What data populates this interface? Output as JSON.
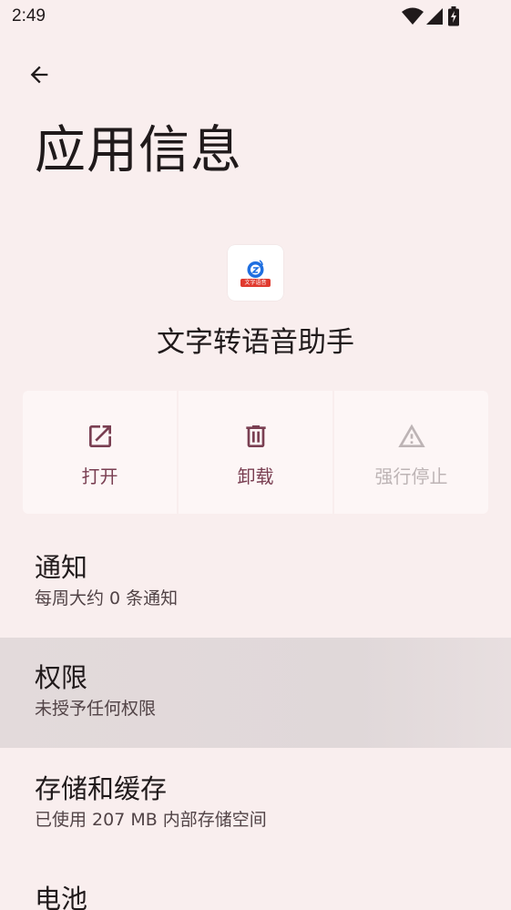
{
  "status_bar": {
    "time": "2:49"
  },
  "header": {
    "title": "应用信息"
  },
  "app": {
    "name": "文字转语音助手",
    "icon_label": "文字语音"
  },
  "actions": [
    {
      "label": "打开",
      "icon": "open-external-icon",
      "enabled": true
    },
    {
      "label": "卸载",
      "icon": "trash-icon",
      "enabled": true
    },
    {
      "label": "强行停止",
      "icon": "warning-icon",
      "enabled": false
    }
  ],
  "settings": [
    {
      "title": "通知",
      "subtitle": "每周大约 0 条通知"
    },
    {
      "title": "权限",
      "subtitle": "未授予任何权限"
    },
    {
      "title": "存储和缓存",
      "subtitle": "已使用 207 MB 内部存储空间"
    },
    {
      "title": "电池",
      "subtitle": ""
    }
  ],
  "colors": {
    "background": "#f9eeee",
    "accent": "#7a3f52",
    "disabled": "#bdb4b5",
    "pressed_row": "#e2d9da"
  }
}
